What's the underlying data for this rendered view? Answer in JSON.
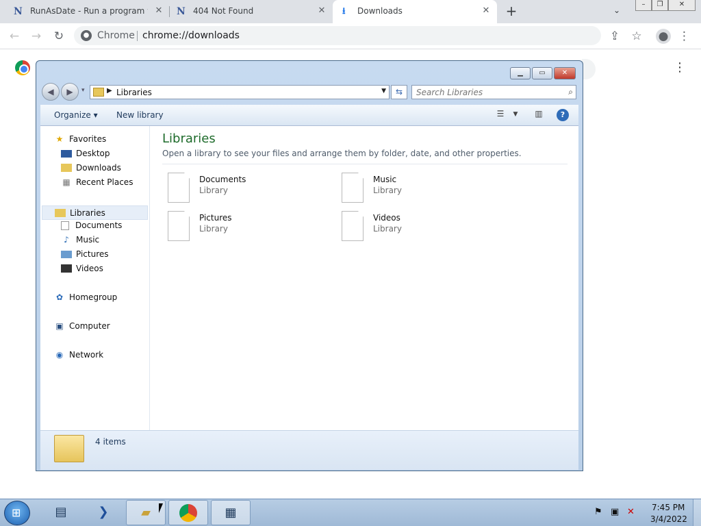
{
  "browser": {
    "tabs": [
      {
        "favicon": "N",
        "title": "RunAsDate - Run a program wit",
        "active": false
      },
      {
        "favicon": "N",
        "title": "404 Not Found",
        "active": false
      },
      {
        "favicon": "download-icon",
        "title": "Downloads",
        "active": true
      }
    ],
    "omnibox": {
      "label": "Chrome",
      "url": "chrome://downloads"
    },
    "window_controls": {
      "minimize": "–",
      "restore": "❐",
      "close": "✕"
    }
  },
  "explorer": {
    "address": "Libraries",
    "search_placeholder": "Search Libraries",
    "commands": {
      "organize": "Organize ▾",
      "new_library": "New library"
    },
    "nav": {
      "favorites": "Favorites",
      "favorites_items": [
        "Desktop",
        "Downloads",
        "Recent Places"
      ],
      "libraries": "Libraries",
      "libraries_items": [
        "Documents",
        "Music",
        "Pictures",
        "Videos"
      ],
      "homegroup": "Homegroup",
      "computer": "Computer",
      "network": "Network"
    },
    "heading": "Libraries",
    "subheading": "Open a library to see your files and arrange them by folder, date, and other properties.",
    "libraries": [
      {
        "name": "Documents",
        "type": "Library"
      },
      {
        "name": "Music",
        "type": "Library"
      },
      {
        "name": "Pictures",
        "type": "Library"
      },
      {
        "name": "Videos",
        "type": "Library"
      }
    ],
    "status": "4 items"
  },
  "taskbar": {
    "time": "7:45 PM",
    "date": "3/4/2022",
    "apps": [
      "server-manager-icon",
      "powershell-icon",
      "explorer-icon",
      "chrome-icon",
      "calendar-app-icon"
    ]
  }
}
